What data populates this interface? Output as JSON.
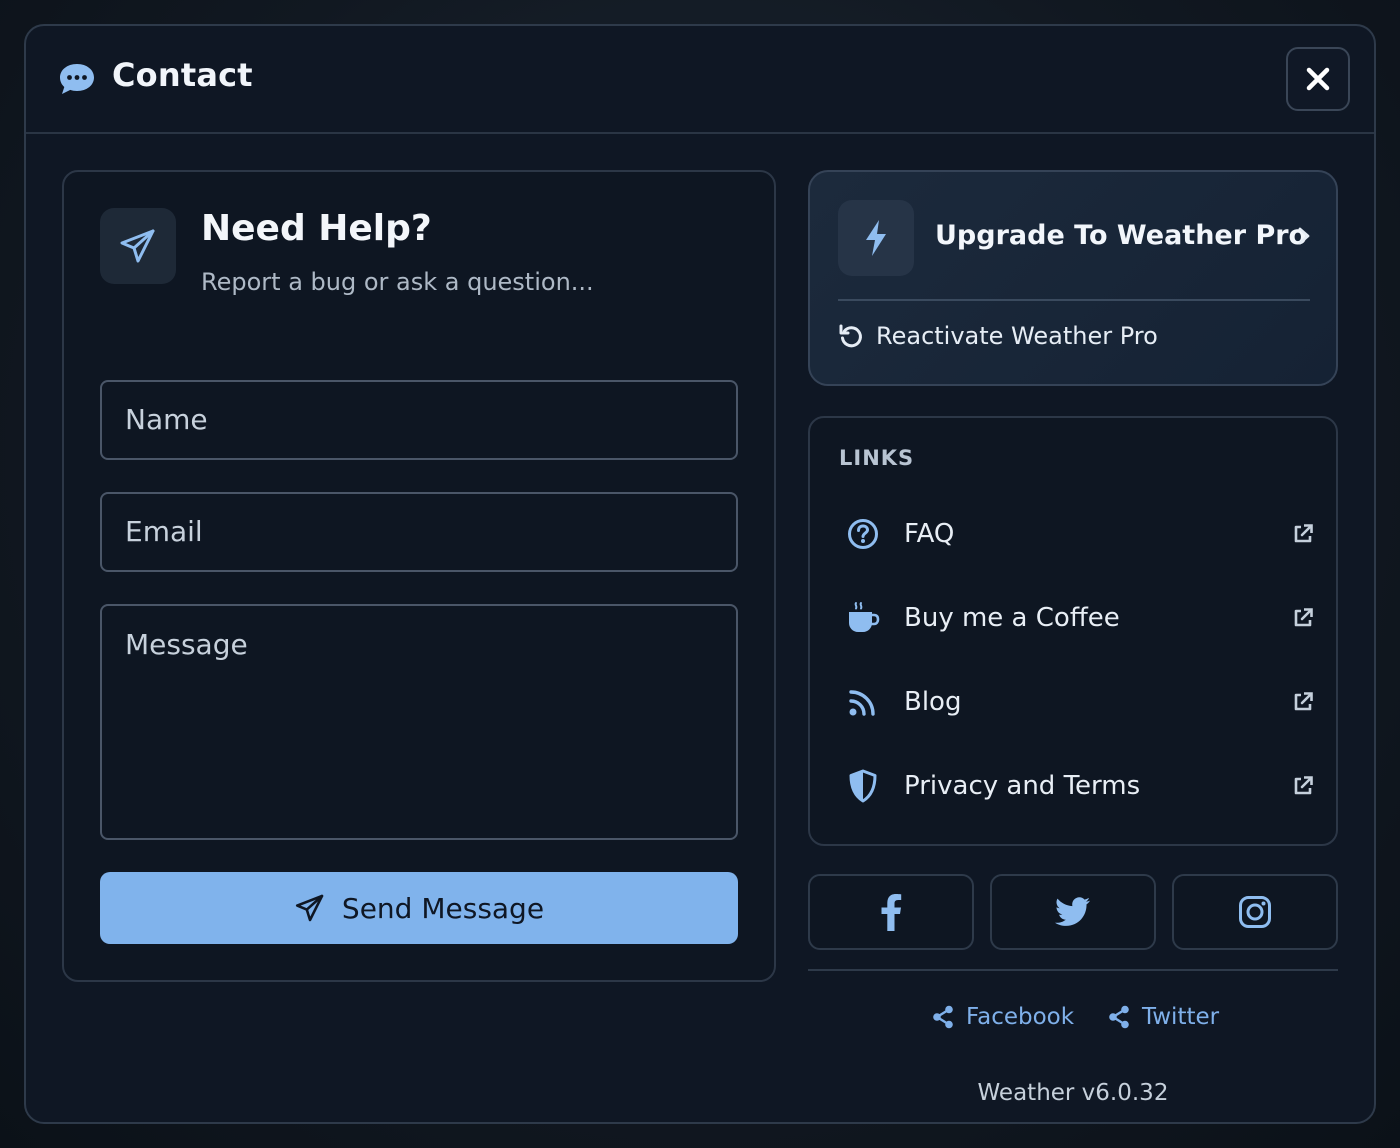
{
  "modal": {
    "title": "Contact",
    "title_icon": "chat-bubble-icon",
    "close_icon": "close-icon"
  },
  "help": {
    "icon": "paper-plane-icon",
    "title": "Need Help?",
    "subtitle": "Report a bug or ask a question...",
    "name_placeholder": "Name",
    "email_placeholder": "Email",
    "message_placeholder": "Message",
    "send_label": "Send Message"
  },
  "upgrade": {
    "icon": "bolt-icon",
    "title": "Upgrade To Weather Pro",
    "reactivate_label": "Reactivate Weather Pro"
  },
  "links": {
    "heading": "LINKS",
    "items": [
      {
        "label": "FAQ",
        "icon": "question-circle-icon"
      },
      {
        "label": "Buy me a Coffee",
        "icon": "coffee-icon"
      },
      {
        "label": "Blog",
        "icon": "rss-icon"
      },
      {
        "label": "Privacy and Terms",
        "icon": "shield-icon"
      }
    ]
  },
  "social": [
    "facebook-icon",
    "twitter-icon",
    "instagram-icon"
  ],
  "share": {
    "facebook_label": "Facebook",
    "twitter_label": "Twitter"
  },
  "version": "Weather v6.0.32",
  "colors": {
    "accent": "#80b3ec",
    "background": "#0f1724",
    "card_border": "#2c3747",
    "link_text": "#7fb0ea"
  }
}
